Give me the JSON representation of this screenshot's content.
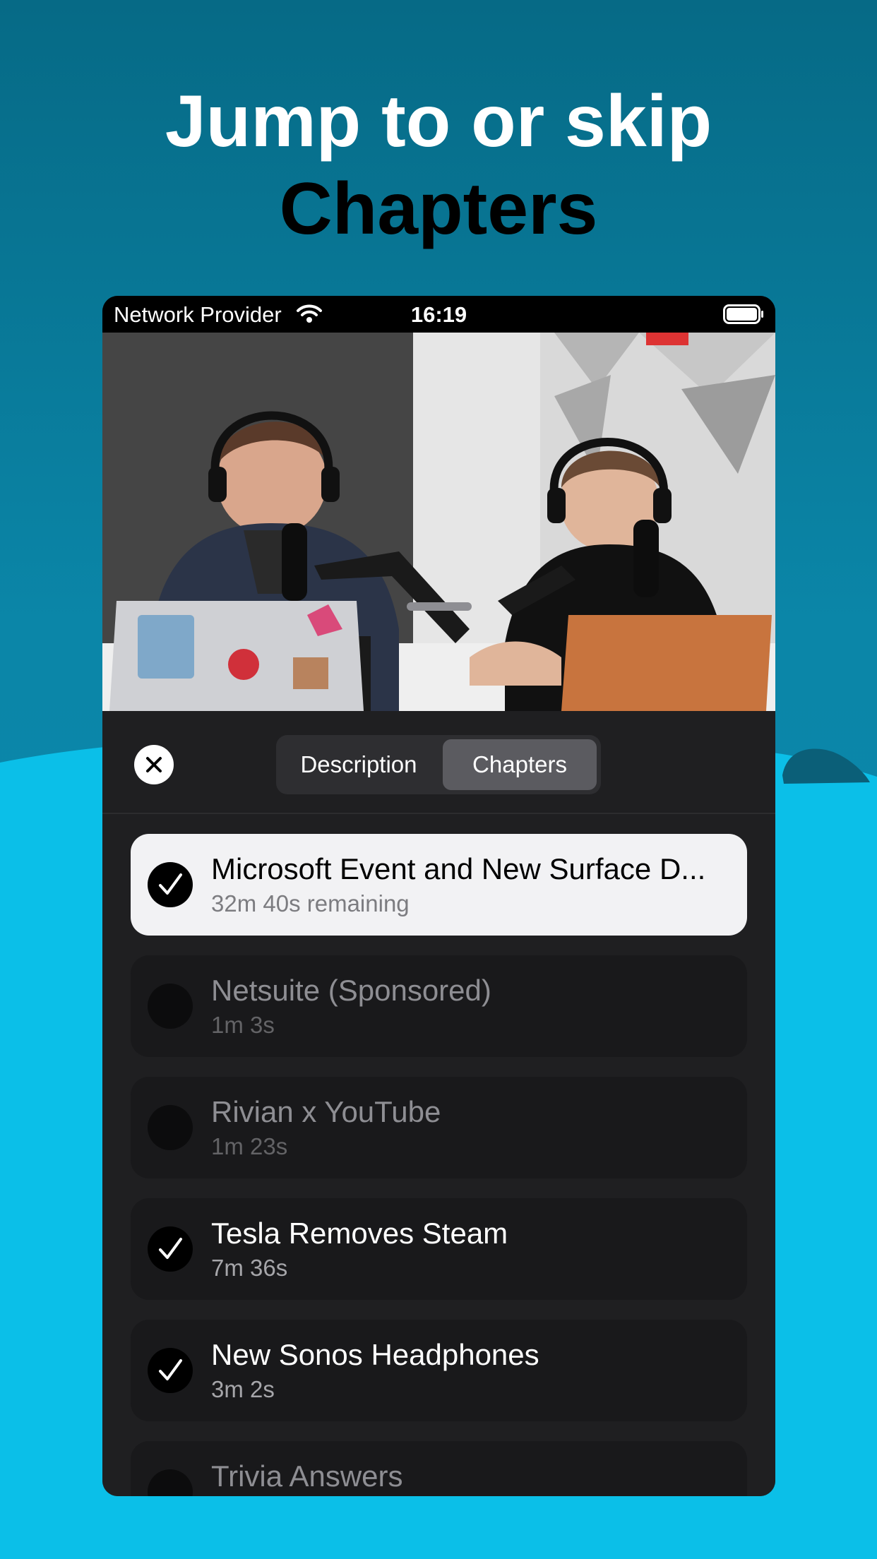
{
  "headline": {
    "line1": "Jump to or skip",
    "line2": "Chapters"
  },
  "status_bar": {
    "provider": "Network Provider",
    "time": "16:19"
  },
  "sheet": {
    "tabs": [
      {
        "label": "Description",
        "selected": false
      },
      {
        "label": "Chapters",
        "selected": true
      }
    ]
  },
  "chapters": [
    {
      "title": "Microsoft Event and New Surface D...",
      "subtitle": "32m 40s remaining",
      "checked": true,
      "state": "current"
    },
    {
      "title": "Netsuite (Sponsored)",
      "subtitle": "1m 3s",
      "checked": false,
      "state": "skipped"
    },
    {
      "title": "Rivian x YouTube",
      "subtitle": "1m 23s",
      "checked": false,
      "state": "skipped"
    },
    {
      "title": "Tesla Removes Steam",
      "subtitle": "7m 36s",
      "checked": true,
      "state": "normal"
    },
    {
      "title": "New Sonos Headphones",
      "subtitle": "3m 2s",
      "checked": true,
      "state": "normal"
    },
    {
      "title": "Trivia Answers",
      "subtitle": "",
      "checked": false,
      "state": "skipped"
    }
  ],
  "colors": {
    "background_top": "#066a86",
    "background_wave": "#0bbfe8",
    "sheet": "#1f1f21"
  },
  "icons": [
    "wifi-icon",
    "battery-icon",
    "close-icon",
    "checkmark-icon"
  ]
}
